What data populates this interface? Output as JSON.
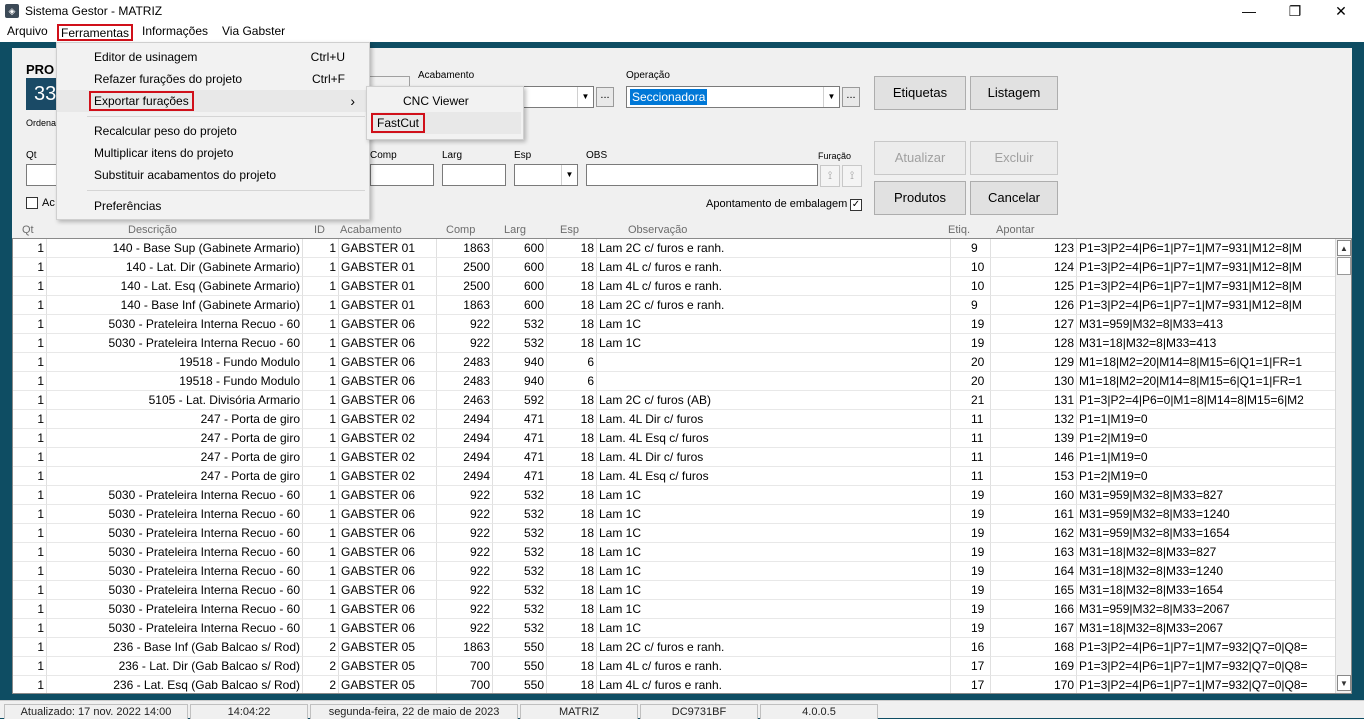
{
  "window": {
    "title": "Sistema Gestor - MATRIZ",
    "icon": "app-logo-icon",
    "controls": {
      "minimize": "—",
      "maximize": "❐",
      "close": "✕"
    }
  },
  "menubar": {
    "items": [
      "Arquivo",
      "Ferramentas",
      "Informações",
      "Via Gabster"
    ]
  },
  "ferramentas_menu": {
    "items": [
      {
        "label": "Editor de usinagem",
        "shortcut": "Ctrl+U"
      },
      {
        "label": "Refazer furações do projeto",
        "shortcut": "Ctrl+F"
      },
      {
        "label": "Exportar furações",
        "shortcut": "›"
      },
      {
        "label": "Recalcular peso do projeto",
        "shortcut": ""
      },
      {
        "label": "Multiplicar itens do projeto",
        "shortcut": ""
      },
      {
        "label": "Substituir acabamentos do projeto",
        "shortcut": ""
      },
      {
        "label": "Preferências",
        "shortcut": ""
      }
    ]
  },
  "exportar_submenu": {
    "items": [
      "CNC Viewer",
      "FastCut"
    ]
  },
  "form": {
    "project_label": "PRO",
    "project_number": "33",
    "ordena_label": "Ordena",
    "acabamento_label": "Acabamento",
    "acabamento_value": "",
    "operacao_label": "Operação",
    "operacao_value": "Seccionadora",
    "ellipsis": "...",
    "qt_label": "Qt",
    "comp_label": "Comp",
    "larg_label": "Larg",
    "esp_label": "Esp",
    "obs_label": "OBS",
    "furacao_label": "Furação",
    "ac_label": "Ac",
    "apontamento_label": "Apontamento de embalagem",
    "apontamento_checked": "✓"
  },
  "buttons": {
    "etiquetas": "Etiquetas",
    "listagem": "Listagem",
    "atualizar": "Atualizar",
    "excluir": "Excluir",
    "produtos": "Produtos",
    "cancelar": "Cancelar"
  },
  "grid": {
    "columns": [
      "Qt",
      "Descrição",
      "ID",
      "Acabamento",
      "Comp",
      "Larg",
      "Esp",
      "Observação",
      "Etiq.",
      "Apontar"
    ],
    "rows": [
      {
        "qt": "1",
        "desc": "140 - Base Sup (Gabinete Armario)",
        "id": "1",
        "acab": "GABSTER 01",
        "comp": "1863",
        "larg": "600",
        "esp": "18",
        "obs": "Lam 2C c/ furos e ranh.",
        "etiq": "9",
        "num": "123",
        "usin": "P1=3|P2=4|P6=1|P7=1|M7=931|M12=8|M"
      },
      {
        "qt": "1",
        "desc": "140 - Lat. Dir (Gabinete Armario)",
        "id": "1",
        "acab": "GABSTER 01",
        "comp": "2500",
        "larg": "600",
        "esp": "18",
        "obs": "Lam 4L c/ furos e ranh.",
        "etiq": "10",
        "num": "124",
        "usin": "P1=3|P2=4|P6=1|P7=1|M7=931|M12=8|M"
      },
      {
        "qt": "1",
        "desc": "140 - Lat. Esq (Gabinete Armario)",
        "id": "1",
        "acab": "GABSTER 01",
        "comp": "2500",
        "larg": "600",
        "esp": "18",
        "obs": "Lam 4L c/ furos e ranh.",
        "etiq": "10",
        "num": "125",
        "usin": "P1=3|P2=4|P6=1|P7=1|M7=931|M12=8|M"
      },
      {
        "qt": "1",
        "desc": "140 - Base Inf (Gabinete Armario)",
        "id": "1",
        "acab": "GABSTER 01",
        "comp": "1863",
        "larg": "600",
        "esp": "18",
        "obs": "Lam 2C c/ furos e ranh.",
        "etiq": "9",
        "num": "126",
        "usin": "P1=3|P2=4|P6=1|P7=1|M7=931|M12=8|M"
      },
      {
        "qt": "1",
        "desc": "5030 - Prateleira Interna Recuo - 60",
        "id": "1",
        "acab": "GABSTER 06",
        "comp": "922",
        "larg": "532",
        "esp": "18",
        "obs": "Lam 1C",
        "etiq": "19",
        "num": "127",
        "usin": "M31=959|M32=8|M33=413"
      },
      {
        "qt": "1",
        "desc": "5030 - Prateleira Interna Recuo - 60",
        "id": "1",
        "acab": "GABSTER 06",
        "comp": "922",
        "larg": "532",
        "esp": "18",
        "obs": "Lam 1C",
        "etiq": "19",
        "num": "128",
        "usin": "M31=18|M32=8|M33=413"
      },
      {
        "qt": "1",
        "desc": "19518 - Fundo Modulo",
        "id": "1",
        "acab": "GABSTER 06",
        "comp": "2483",
        "larg": "940",
        "esp": "6",
        "obs": "",
        "etiq": "20",
        "num": "129",
        "usin": "M1=18|M2=20|M14=8|M15=6|Q1=1|FR=1"
      },
      {
        "qt": "1",
        "desc": "19518 - Fundo Modulo",
        "id": "1",
        "acab": "GABSTER 06",
        "comp": "2483",
        "larg": "940",
        "esp": "6",
        "obs": "",
        "etiq": "20",
        "num": "130",
        "usin": "M1=18|M2=20|M14=8|M15=6|Q1=1|FR=1"
      },
      {
        "qt": "1",
        "desc": "5105 - Lat. Divisória Armario",
        "id": "1",
        "acab": "GABSTER 06",
        "comp": "2463",
        "larg": "592",
        "esp": "18",
        "obs": "Lam 2C c/ furos (AB)",
        "etiq": "21",
        "num": "131",
        "usin": "P1=3|P2=4|P6=0|M1=8|M14=8|M15=6|M2"
      },
      {
        "qt": "1",
        "desc": "247 - Porta de giro",
        "id": "1",
        "acab": "GABSTER 02",
        "comp": "2494",
        "larg": "471",
        "esp": "18",
        "obs": "Lam. 4L Dir c/ furos",
        "etiq": "11",
        "num": "132",
        "usin": "P1=1|M19=0"
      },
      {
        "qt": "1",
        "desc": "247 - Porta de giro",
        "id": "1",
        "acab": "GABSTER 02",
        "comp": "2494",
        "larg": "471",
        "esp": "18",
        "obs": "Lam. 4L Esq c/ furos",
        "etiq": "11",
        "num": "139",
        "usin": "P1=2|M19=0"
      },
      {
        "qt": "1",
        "desc": "247 - Porta de giro",
        "id": "1",
        "acab": "GABSTER 02",
        "comp": "2494",
        "larg": "471",
        "esp": "18",
        "obs": "Lam. 4L Dir c/ furos",
        "etiq": "11",
        "num": "146",
        "usin": "P1=1|M19=0"
      },
      {
        "qt": "1",
        "desc": "247 - Porta de giro",
        "id": "1",
        "acab": "GABSTER 02",
        "comp": "2494",
        "larg": "471",
        "esp": "18",
        "obs": "Lam. 4L Esq c/ furos",
        "etiq": "11",
        "num": "153",
        "usin": "P1=2|M19=0"
      },
      {
        "qt": "1",
        "desc": "5030 - Prateleira Interna Recuo - 60",
        "id": "1",
        "acab": "GABSTER 06",
        "comp": "922",
        "larg": "532",
        "esp": "18",
        "obs": "Lam 1C",
        "etiq": "19",
        "num": "160",
        "usin": "M31=959|M32=8|M33=827"
      },
      {
        "qt": "1",
        "desc": "5030 - Prateleira Interna Recuo - 60",
        "id": "1",
        "acab": "GABSTER 06",
        "comp": "922",
        "larg": "532",
        "esp": "18",
        "obs": "Lam 1C",
        "etiq": "19",
        "num": "161",
        "usin": "M31=959|M32=8|M33=1240"
      },
      {
        "qt": "1",
        "desc": "5030 - Prateleira Interna Recuo - 60",
        "id": "1",
        "acab": "GABSTER 06",
        "comp": "922",
        "larg": "532",
        "esp": "18",
        "obs": "Lam 1C",
        "etiq": "19",
        "num": "162",
        "usin": "M31=959|M32=8|M33=1654"
      },
      {
        "qt": "1",
        "desc": "5030 - Prateleira Interna Recuo - 60",
        "id": "1",
        "acab": "GABSTER 06",
        "comp": "922",
        "larg": "532",
        "esp": "18",
        "obs": "Lam 1C",
        "etiq": "19",
        "num": "163",
        "usin": "M31=18|M32=8|M33=827"
      },
      {
        "qt": "1",
        "desc": "5030 - Prateleira Interna Recuo - 60",
        "id": "1",
        "acab": "GABSTER 06",
        "comp": "922",
        "larg": "532",
        "esp": "18",
        "obs": "Lam 1C",
        "etiq": "19",
        "num": "164",
        "usin": "M31=18|M32=8|M33=1240"
      },
      {
        "qt": "1",
        "desc": "5030 - Prateleira Interna Recuo - 60",
        "id": "1",
        "acab": "GABSTER 06",
        "comp": "922",
        "larg": "532",
        "esp": "18",
        "obs": "Lam 1C",
        "etiq": "19",
        "num": "165",
        "usin": "M31=18|M32=8|M33=1654"
      },
      {
        "qt": "1",
        "desc": "5030 - Prateleira Interna Recuo - 60",
        "id": "1",
        "acab": "GABSTER 06",
        "comp": "922",
        "larg": "532",
        "esp": "18",
        "obs": "Lam 1C",
        "etiq": "19",
        "num": "166",
        "usin": "M31=959|M32=8|M33=2067"
      },
      {
        "qt": "1",
        "desc": "5030 - Prateleira Interna Recuo - 60",
        "id": "1",
        "acab": "GABSTER 06",
        "comp": "922",
        "larg": "532",
        "esp": "18",
        "obs": "Lam 1C",
        "etiq": "19",
        "num": "167",
        "usin": "M31=18|M32=8|M33=2067"
      },
      {
        "qt": "1",
        "desc": "236 - Base Inf (Gab Balcao s/ Rod)",
        "id": "2",
        "acab": "GABSTER 05",
        "comp": "1863",
        "larg": "550",
        "esp": "18",
        "obs": "Lam 2C c/ furos e ranh.",
        "etiq": "16",
        "num": "168",
        "usin": "P1=3|P2=4|P6=1|P7=1|M7=932|Q7=0|Q8="
      },
      {
        "qt": "1",
        "desc": "236 - Lat. Dir (Gab Balcao s/ Rod)",
        "id": "2",
        "acab": "GABSTER 05",
        "comp": "700",
        "larg": "550",
        "esp": "18",
        "obs": "Lam 4L c/ furos e ranh.",
        "etiq": "17",
        "num": "169",
        "usin": "P1=3|P2=4|P6=1|P7=1|M7=932|Q7=0|Q8="
      },
      {
        "qt": "1",
        "desc": "236 - Lat. Esq (Gab Balcao s/ Rod)",
        "id": "2",
        "acab": "GABSTER 05",
        "comp": "700",
        "larg": "550",
        "esp": "18",
        "obs": "Lam 4L c/ furos e ranh.",
        "etiq": "17",
        "num": "170",
        "usin": "P1=3|P2=4|P6=1|P7=1|M7=932|Q7=0|Q8="
      }
    ]
  },
  "statusbar": {
    "items": [
      "Atualizado: 17 nov. 2022 14:00",
      "14:04:22",
      "segunda-feira, 22 de maio de 2023",
      "MATRIZ",
      "DC9731BF",
      "4.0.0.5"
    ]
  },
  "colors": {
    "highlight_red": "#d0101a",
    "project_box": "#1a4a66",
    "background": "#0e4d63"
  }
}
